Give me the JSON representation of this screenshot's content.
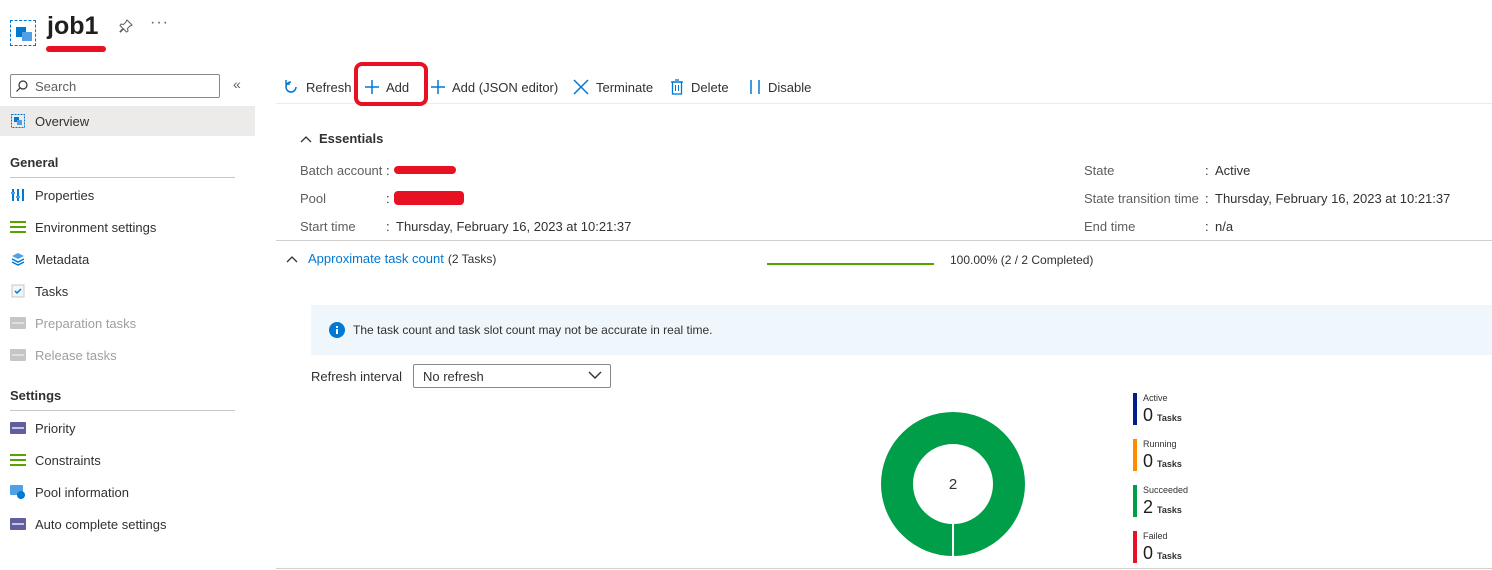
{
  "header": {
    "title": "job1",
    "more": "···"
  },
  "sidebar": {
    "search_placeholder": "Search",
    "collapse": "«",
    "overview": "Overview",
    "general_heading": "General",
    "general_items": [
      {
        "label": "Properties"
      },
      {
        "label": "Environment settings"
      },
      {
        "label": "Metadata"
      },
      {
        "label": "Tasks"
      },
      {
        "label": "Preparation tasks"
      },
      {
        "label": "Release tasks"
      }
    ],
    "settings_heading": "Settings",
    "settings_items": [
      {
        "label": "Priority"
      },
      {
        "label": "Constraints"
      },
      {
        "label": "Pool information"
      },
      {
        "label": "Auto complete settings"
      }
    ]
  },
  "toolbar": {
    "refresh": "Refresh",
    "add": "Add",
    "add_json": "Add (JSON editor)",
    "terminate": "Terminate",
    "delete": "Delete",
    "disable": "Disable"
  },
  "essentials": {
    "heading": "Essentials",
    "batch_account_label": "Batch account",
    "pool_label": "Pool",
    "start_time_label": "Start time",
    "start_time_value": "Thursday, February 16, 2023 at 10:21:37",
    "state_label": "State",
    "state_value": "Active",
    "state_transition_label": "State transition time",
    "state_transition_value": "Thursday, February 16, 2023 at 10:21:37",
    "end_time_label": "End time",
    "end_time_value": "n/a",
    "colon": ":"
  },
  "task_count": {
    "title": "Approximate task count",
    "subtitle": "(2 Tasks)",
    "progress_text": "100.00% (2 / 2 Completed)",
    "progress_fraction": 1.0,
    "info": "The task count and task slot count may not be accurate in real time.",
    "refresh_interval_label": "Refresh interval",
    "refresh_interval_value": "No refresh",
    "donut_total": "2",
    "legend": [
      {
        "name": "Active",
        "count": "0",
        "unit": "Tasks",
        "color": "#001f8c"
      },
      {
        "name": "Running",
        "count": "0",
        "unit": "Tasks",
        "color": "#ff8c00"
      },
      {
        "name": "Succeeded",
        "count": "2",
        "unit": "Tasks",
        "color": "#009e49"
      },
      {
        "name": "Failed",
        "count": "0",
        "unit": "Tasks",
        "color": "#e81123"
      }
    ]
  },
  "colors": {
    "accent": "#0078d4",
    "success": "#009e49",
    "highlight": "#e81123",
    "progress": "#57a300"
  }
}
